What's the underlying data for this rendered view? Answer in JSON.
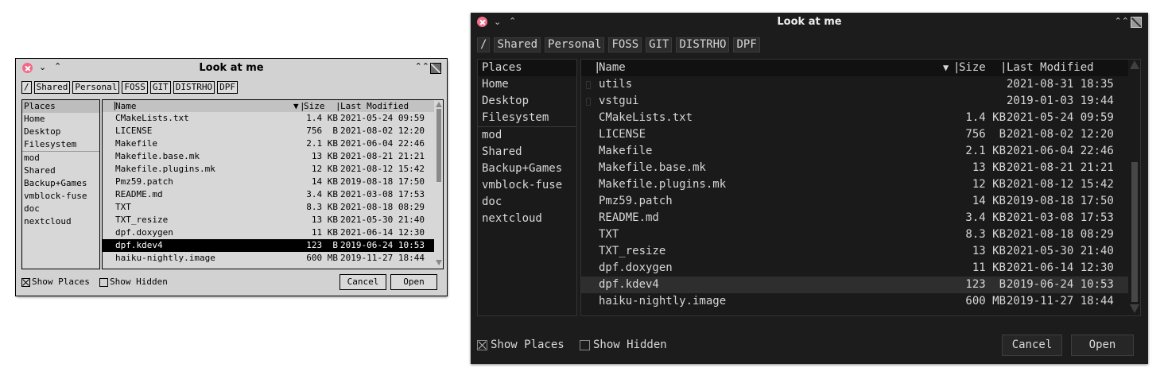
{
  "light": {
    "title": "Look at me",
    "path": [
      "/",
      "Shared",
      "Personal",
      "FOSS",
      "GIT",
      "DISTRHO",
      "DPF"
    ],
    "places_header": "Places",
    "places": [
      "Home",
      "Desktop",
      "Filesystem"
    ],
    "bookmarks": [
      "mod",
      "Shared",
      "Backup+Games",
      "vmblock-fuse",
      "doc",
      "nextcloud"
    ],
    "columns": {
      "name": "Name",
      "sort_arrow": "▼",
      "size": "Size",
      "modified": "Last Modified"
    },
    "files": [
      {
        "name": "CMakeLists.txt",
        "size": "1.4 KB",
        "modified": "2021-05-24 09:59"
      },
      {
        "name": "LICENSE",
        "size": "756  B",
        "modified": "2021-08-02 12:20"
      },
      {
        "name": "Makefile",
        "size": "2.1 KB",
        "modified": "2021-06-04 22:46"
      },
      {
        "name": "Makefile.base.mk",
        "size": "13 KB",
        "modified": "2021-08-21 21:21"
      },
      {
        "name": "Makefile.plugins.mk",
        "size": "12 KB",
        "modified": "2021-08-12 15:42"
      },
      {
        "name": "Pmz59.patch",
        "size": "14 KB",
        "modified": "2019-08-18 17:50"
      },
      {
        "name": "README.md",
        "size": "3.4 KB",
        "modified": "2021-03-08 17:53"
      },
      {
        "name": "TXT",
        "size": "8.3 KB",
        "modified": "2021-08-18 08:29"
      },
      {
        "name": "TXT_resize",
        "size": "13 KB",
        "modified": "2021-05-30 21:40"
      },
      {
        "name": "dpf.doxygen",
        "size": "11 KB",
        "modified": "2021-06-14 12:30"
      },
      {
        "name": "dpf.kdev4",
        "size": "123  B",
        "modified": "2019-06-24 10:53"
      },
      {
        "name": "haiku-nightly.image",
        "size": "600 MB",
        "modified": "2019-11-27 18:44"
      }
    ],
    "selected_index": 10,
    "show_places_label": "Show Places",
    "show_places_checked": true,
    "show_hidden_label": "Show Hidden",
    "show_hidden_checked": false,
    "cancel_label": "Cancel",
    "open_label": "Open"
  },
  "dark": {
    "title": "Look at me",
    "path": [
      "/",
      "Shared",
      "Personal",
      "FOSS",
      "GIT",
      "DISTRHO",
      "DPF"
    ],
    "places_header": "Places",
    "places": [
      "Home",
      "Desktop",
      "Filesystem"
    ],
    "bookmarks": [
      "mod",
      "Shared",
      "Backup+Games",
      "vmblock-fuse",
      "doc",
      "nextcloud"
    ],
    "columns": {
      "name": "Name",
      "sort_arrow": "▼",
      "size": "Size",
      "modified": "Last Modified"
    },
    "files": [
      {
        "name": "utils",
        "size": "",
        "modified": "2021-08-31 18:35",
        "dir": true
      },
      {
        "name": "vstgui",
        "size": "",
        "modified": "2019-01-03 19:44",
        "dir": true
      },
      {
        "name": "CMakeLists.txt",
        "size": "1.4 KB",
        "modified": "2021-05-24 09:59"
      },
      {
        "name": "LICENSE",
        "size": "756  B",
        "modified": "2021-08-02 12:20"
      },
      {
        "name": "Makefile",
        "size": "2.1 KB",
        "modified": "2021-06-04 22:46"
      },
      {
        "name": "Makefile.base.mk",
        "size": "13 KB",
        "modified": "2021-08-21 21:21"
      },
      {
        "name": "Makefile.plugins.mk",
        "size": "12 KB",
        "modified": "2021-08-12 15:42"
      },
      {
        "name": "Pmz59.patch",
        "size": "14 KB",
        "modified": "2019-08-18 17:50"
      },
      {
        "name": "README.md",
        "size": "3.4 KB",
        "modified": "2021-03-08 17:53"
      },
      {
        "name": "TXT",
        "size": "8.3 KB",
        "modified": "2021-08-18 08:29"
      },
      {
        "name": "TXT_resize",
        "size": "13 KB",
        "modified": "2021-05-30 21:40"
      },
      {
        "name": "dpf.doxygen",
        "size": "11 KB",
        "modified": "2021-06-14 12:30"
      },
      {
        "name": "dpf.kdev4",
        "size": "123  B",
        "modified": "2019-06-24 10:53"
      },
      {
        "name": "haiku-nightly.image",
        "size": "600 MB",
        "modified": "2019-11-27 18:44"
      }
    ],
    "selected_index": 12,
    "show_places_label": "Show Places",
    "show_places_checked": true,
    "show_hidden_label": "Show Hidden",
    "show_hidden_checked": false,
    "cancel_label": "Cancel",
    "open_label": "Open"
  }
}
